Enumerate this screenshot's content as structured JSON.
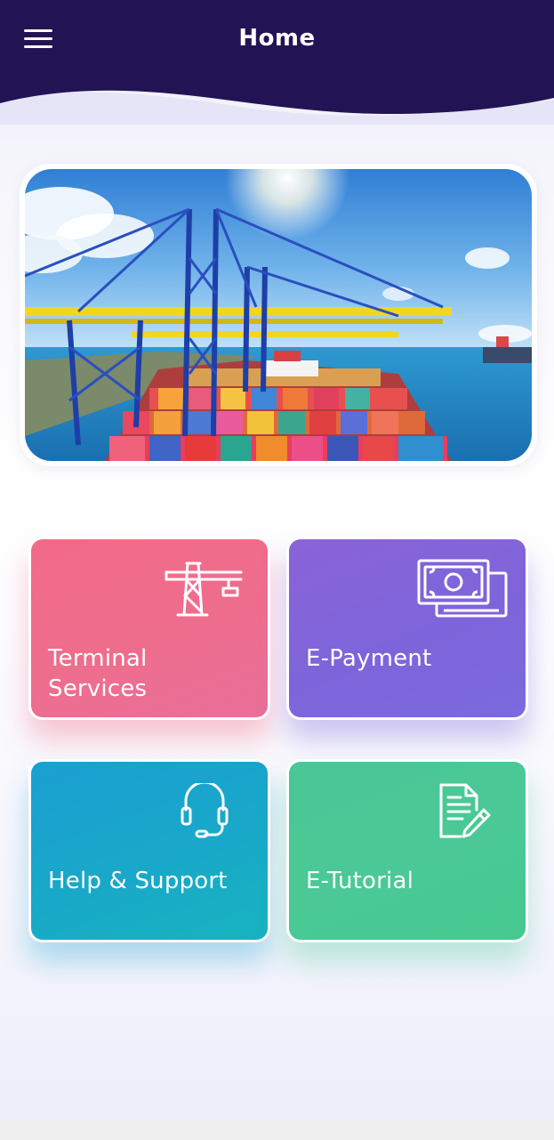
{
  "header": {
    "title": "Home",
    "menu_icon": "hamburger-menu-icon",
    "background_color": "#221454"
  },
  "banner": {
    "image_description_icon": "port-cranes-container-ship-photo"
  },
  "tiles": [
    {
      "label_line1": "Terminal",
      "label_line2": "Services",
      "icon": "crane-icon",
      "color": "#ef6b8b"
    },
    {
      "label_line1": "E-Payment",
      "icon": "money-bills-icon",
      "color": "#7f64da"
    },
    {
      "label_line1": "Help & Support",
      "icon": "headset-icon",
      "color": "#19a6cb"
    },
    {
      "label_line1": "E-Tutorial",
      "icon": "document-pen-icon",
      "color": "#4ac794"
    }
  ]
}
